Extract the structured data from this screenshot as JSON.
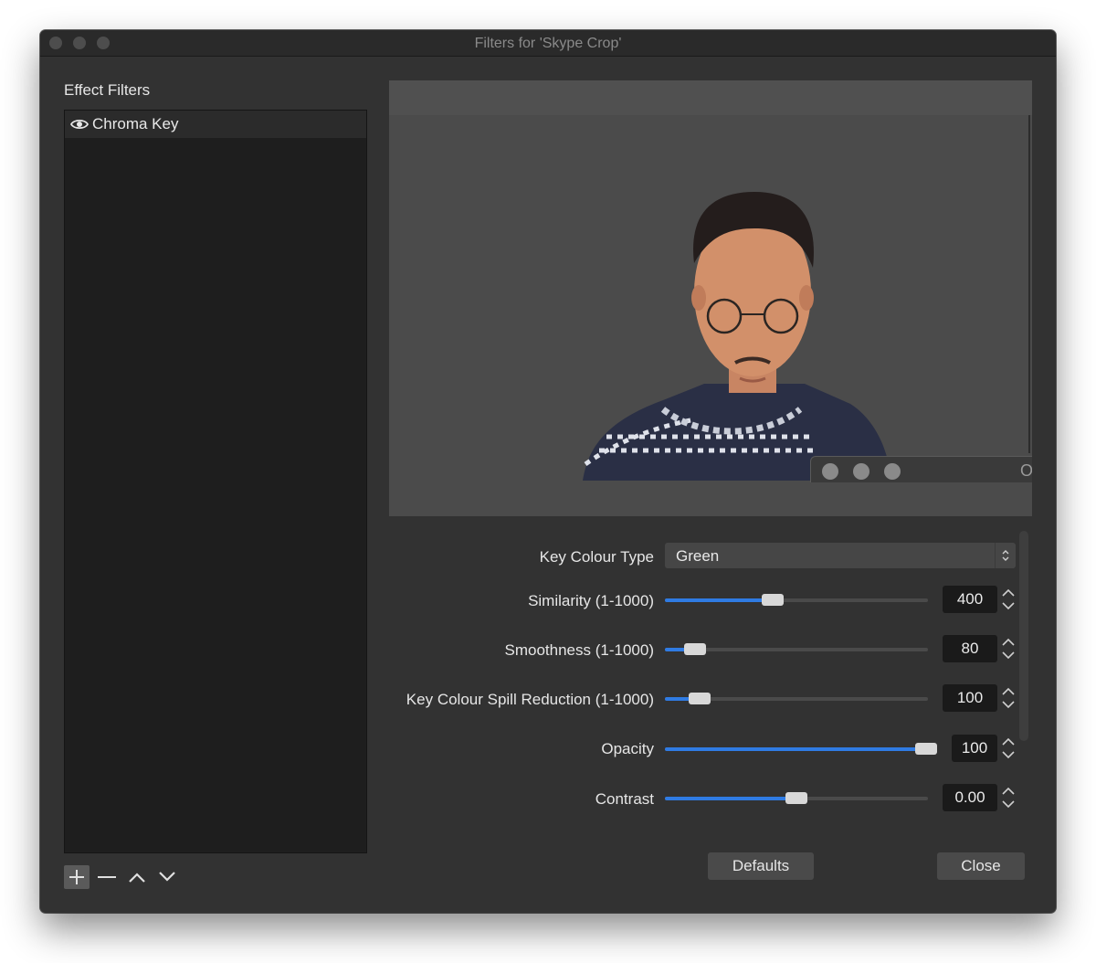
{
  "window": {
    "title": "Filters for 'Skype Crop'"
  },
  "filters_panel": {
    "label": "Effect Filters",
    "items": [
      {
        "label": "Chroma Key",
        "icon": "eye-icon"
      }
    ],
    "tools": [
      "plus-icon",
      "minus-icon",
      "chevron-up-icon",
      "chevron-down-icon"
    ]
  },
  "preview": {
    "description_icon": "webcam-preview",
    "overlay_partial_text": "O"
  },
  "settings": {
    "key_colour_type": {
      "label": "Key Colour Type",
      "value": "Green"
    },
    "similarity": {
      "label": "Similarity (1-1000)",
      "value": "400",
      "fraction": 0.4
    },
    "smoothness": {
      "label": "Smoothness (1-1000)",
      "value": "80",
      "fraction": 0.08
    },
    "spill": {
      "label": "Key Colour Spill Reduction (1-1000)",
      "value": "100",
      "fraction": 0.1
    },
    "opacity": {
      "label": "Opacity",
      "value": "100",
      "fraction": 1.0
    },
    "contrast": {
      "label": "Contrast",
      "value": "0.00",
      "fraction": 0.5
    }
  },
  "buttons": {
    "defaults": "Defaults",
    "close": "Close"
  },
  "colors": {
    "accent": "#2f7be3",
    "window_bg": "#323232",
    "list_bg": "#1e1e1e"
  }
}
